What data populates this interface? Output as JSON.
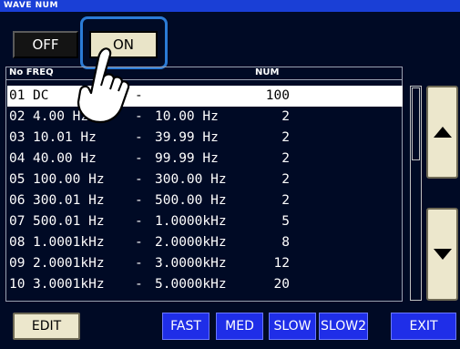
{
  "window": {
    "title": "WAVE NUM"
  },
  "toggle": {
    "off_label": "OFF",
    "on_label": "ON",
    "selected": "ON"
  },
  "table": {
    "columns": {
      "no_freq": "No FREQ",
      "num": "NUM"
    },
    "rows": [
      {
        "no": "01",
        "from": "DC",
        "dash": "-",
        "to": "",
        "num": "100"
      },
      {
        "no": "02",
        "from": "4.00 Hz",
        "dash": "-",
        "to": "10.00 Hz",
        "num": "2"
      },
      {
        "no": "03",
        "from": "10.01 Hz",
        "dash": "-",
        "to": "39.99 Hz",
        "num": "2"
      },
      {
        "no": "04",
        "from": "40.00 Hz",
        "dash": "-",
        "to": "99.99 Hz",
        "num": "2"
      },
      {
        "no": "05",
        "from": "100.00 Hz",
        "dash": "-",
        "to": "300.00 Hz",
        "num": "2"
      },
      {
        "no": "06",
        "from": "300.01 Hz",
        "dash": "-",
        "to": "500.00 Hz",
        "num": "2"
      },
      {
        "no": "07",
        "from": "500.01 Hz",
        "dash": "-",
        "to": "1.0000kHz",
        "num": "5"
      },
      {
        "no": "08",
        "from": "1.0001kHz",
        "dash": "-",
        "to": "2.0000kHz",
        "num": "8"
      },
      {
        "no": "09",
        "from": "2.0001kHz",
        "dash": "-",
        "to": "3.0000kHz",
        "num": "12"
      },
      {
        "no": "10",
        "from": "3.0001kHz",
        "dash": "-",
        "to": "5.0000kHz",
        "num": "20"
      }
    ],
    "selected_row": "01"
  },
  "scroll": {
    "up_icon": "arrow-up-icon",
    "down_icon": "arrow-down-icon"
  },
  "bottom": {
    "edit_label": "EDIT",
    "fast_label": "FAST",
    "med_label": "MED",
    "slow_label": "SLOW",
    "slow2_label": "SLOW2",
    "exit_label": "EXIT"
  },
  "colors": {
    "background": "#000a25",
    "titlebar": "#1a3fd6",
    "on_button": "#e9e4c8",
    "speed_button": "#1f2ee8",
    "highlight": "#2b7bd6"
  }
}
